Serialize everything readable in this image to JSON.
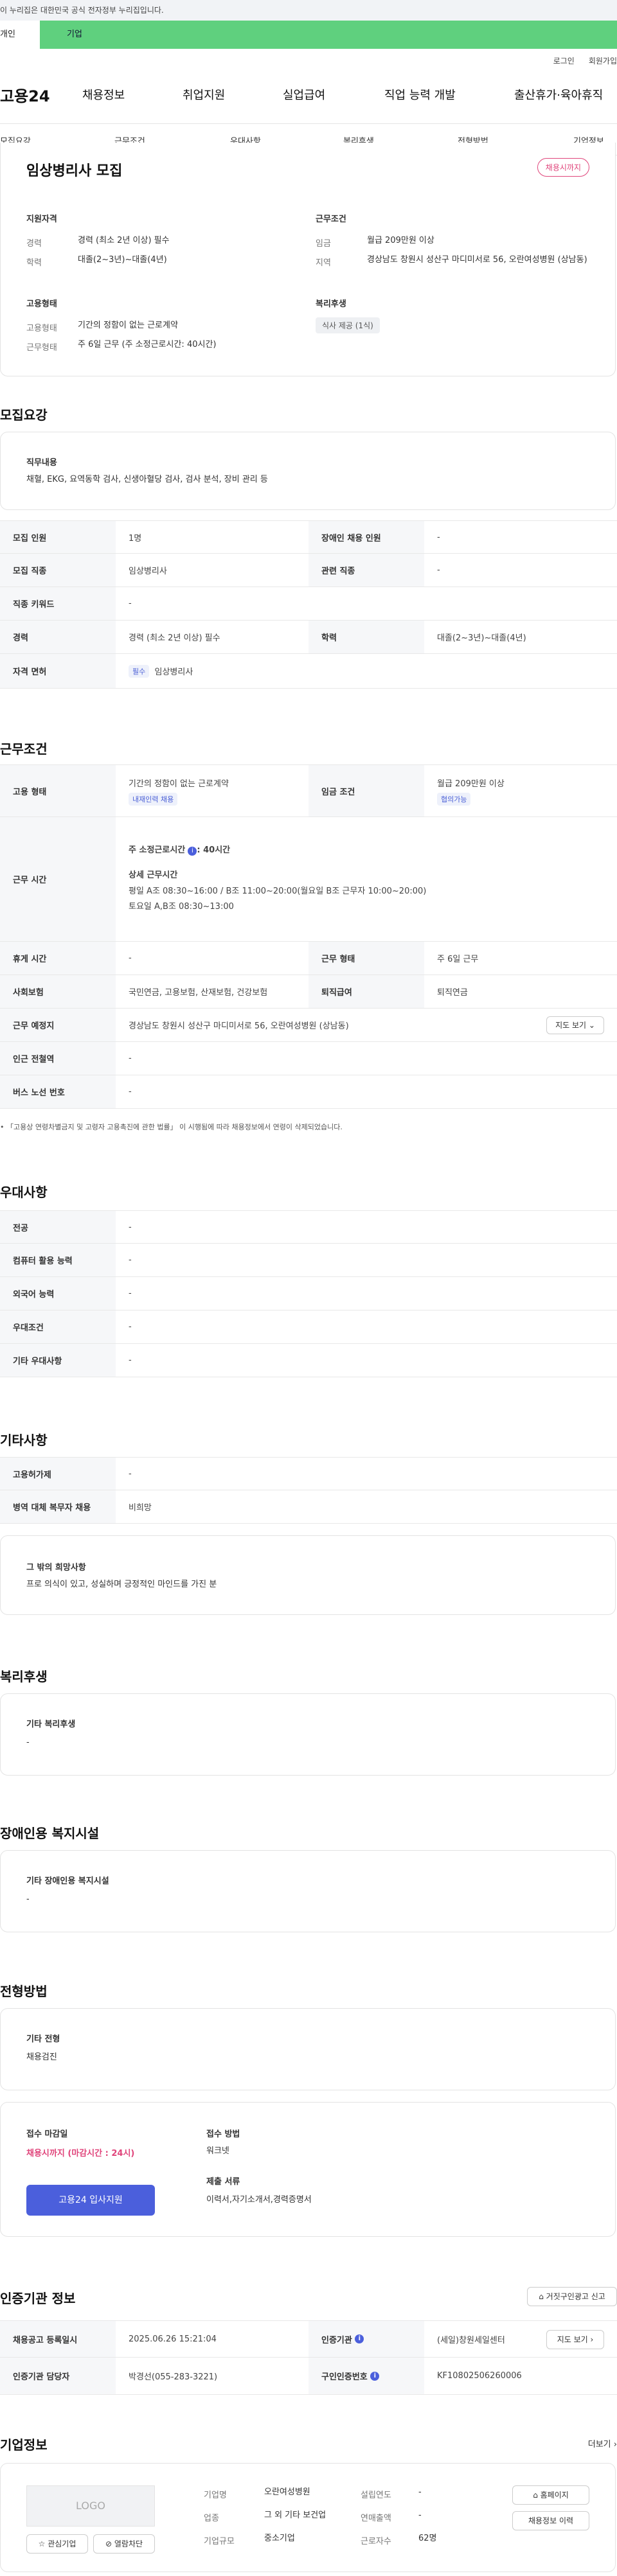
{
  "gov_banner": "이 누리집은 대한민국 공식 전자정부 누리집입니다.",
  "user_tabs": {
    "individual": "개인",
    "company": "기업"
  },
  "util": {
    "login": "로그인",
    "join": "회원가입"
  },
  "gnb": {
    "logo": "고용24",
    "menu": [
      "채용정보",
      "취업지원",
      "실업급여",
      "직업 능력 개발",
      "출산휴가·육아휴직"
    ]
  },
  "subnav": [
    "모집요강",
    "근무조건",
    "우대사항",
    "복리후생",
    "전형방법",
    "기업정보"
  ],
  "summary": {
    "title": "임상병리사 모집",
    "badge": "채용시까지",
    "qual_title": "지원자격",
    "career_label": "경력",
    "career": "경력 (최소 2년 이상) 필수",
    "edu_label": "학력",
    "edu": "대졸(2~3년)~대졸(4년)",
    "cond_title": "근무조건",
    "wage_label": "임금",
    "wage": "월급 209만원 이상",
    "region_label": "지역",
    "region": "경상남도 창원시 성산구 마디미서로 56, 오란여성병원 (상남동)",
    "emp_title": "고용형태",
    "emp_label": "고용형태",
    "emp": "기간의 정함이 없는 근로계약",
    "worktype_label": "근무형태",
    "worktype": "주 6일 근무 (주 소정근로시간: 40시간)",
    "welfare_title": "복리후생",
    "welfare_chip": "식사 제공 (1식)"
  },
  "recruit": {
    "section": "모집요강",
    "duty_title": "직무내용",
    "duty": "채혈, EKG, 요역동학 검사, 신생아혈당 검사, 검사 분석, 장비 관리 등",
    "rows": [
      {
        "k": "모집 인원",
        "v": "1명",
        "k2": "장애인 채용 인원",
        "v2": "-"
      },
      {
        "k": "모집 직종",
        "v": "임상병리사",
        "k2": "관련 직종",
        "v2": "-"
      },
      {
        "k": "직종 키워드",
        "v": "-"
      },
      {
        "k": "경력",
        "v": "경력 (최소 2년 이상) 필수",
        "k2": "학력",
        "v2": "대졸(2~3년)~대졸(4년)"
      },
      {
        "k": "자격 면허",
        "v": "임상병리사",
        "chip": "필수"
      }
    ]
  },
  "work": {
    "section": "근무조건",
    "emp_k": "고용 형태",
    "emp_v": "기간의 정함이 없는 근로계약",
    "emp_chip": "내재인력 채용",
    "wage_k": "임금 조건",
    "wage_v": "월급 209만원 이상",
    "wage_chip": "협의가능",
    "hours_k": "근무 시간",
    "hours_main": "주 소정근로시간",
    "hours_main2": ": 40시간",
    "hours_detail_title": "상세 근무시간",
    "hours_l1": "평일  A조 08:30~16:00  / B조 11:00~20:00(월요일 B조 근무자 10:00~20:00)",
    "hours_l2": "토요일  A,B조 08:30~13:00",
    "rest_k": "휴게 시간",
    "rest_v": "-",
    "shift_k": "근무 형태",
    "shift_v": "주 6일 근무",
    "ins_k": "사회보험",
    "ins_v": "국민연금, 고용보험, 산재보험, 건강보험",
    "ret_k": "퇴직급여",
    "ret_v": "퇴직연금",
    "place_k": "근무 예정지",
    "place_v": "경상남도 창원시 성산구 마디미서로 56, 오란여성병원 (상남동)",
    "map_btn": "지도 보기",
    "station_k": "인근 전철역",
    "station_v": "-",
    "bus_k": "버스 노선 번호",
    "bus_v": "-",
    "note": "「고용상 연령차별금지 및 고령자 고용촉진에 관한 법률」 이 시행됨에 따라 채용정보에서 연령이 삭제되었습니다."
  },
  "pref": {
    "section": "우대사항",
    "rows": [
      {
        "k": "전공",
        "v": "-"
      },
      {
        "k": "컴퓨터 활용 능력",
        "v": "-"
      },
      {
        "k": "외국어 능력",
        "v": "-"
      },
      {
        "k": "우대조건",
        "v": "-"
      },
      {
        "k": "기타 우대사항",
        "v": "-"
      }
    ]
  },
  "etc": {
    "section": "기타사항",
    "rows": [
      {
        "k": "고용허가제",
        "v": "-"
      },
      {
        "k": "병역 대체 복무자 채용",
        "v": "비희망"
      }
    ],
    "hope_title": "그 밖의 희망사항",
    "hope": "프로 의식이 있고, 성실하며 긍정적인 마인드를 가진 분"
  },
  "benefit": {
    "section": "복리후생",
    "title": "기타 복리후생",
    "v": "-"
  },
  "disab": {
    "section": "장애인용 복지시설",
    "title": "기타 장애인용 복지시설",
    "v": "-"
  },
  "process": {
    "section": "전형방법",
    "title": "기타 전형",
    "v": "채용검진",
    "deadline_title": "접수 마감일",
    "deadline": "채용시까지 (마감시간 : 24시)",
    "method_title": "접수 방법",
    "method": "워크넷",
    "docs_title": "제출 서류",
    "docs": "이력서,자기소개서,경력증명서",
    "apply_btn": "고용24 입사지원"
  },
  "agency": {
    "section": "인증기관 정보",
    "report_btn": "거짓구인광고 신고",
    "reg_k": "채용공고 등록일시",
    "reg_v": "2025.06.26 15:21:04",
    "org_k": "인증기관",
    "org_v": "(세일)창원세일센터",
    "map_btn": "지도 보기",
    "mgr_k": "인증기관 담당자",
    "mgr_v": "박경선(055-283-3221)",
    "num_k": "구인인증번호",
    "num_v": "KF10802506260006"
  },
  "company": {
    "section": "기업정보",
    "more": "더보기",
    "logo": "LOGO",
    "fav": "관심기업",
    "block": "열람차단",
    "name_k": "기업명",
    "name_v": "오란여성병원",
    "year_k": "설립연도",
    "year_v": "-",
    "ind_k": "업종",
    "ind_v": "그 외 기타 보건업",
    "sales_k": "연매출액",
    "sales_v": "-",
    "size_k": "기업규모",
    "size_v": "중소기업",
    "emp_k": "근로자수",
    "emp_v": "62명",
    "home_btn": "홈페이지",
    "jobs_btn": "채용정보 이력"
  }
}
